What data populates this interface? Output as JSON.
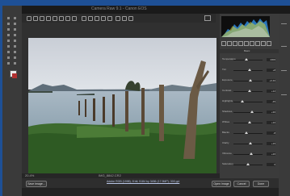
{
  "window": {
    "title": "Camera Raw 9.1 - Canon EOS"
  },
  "panel": {
    "section_title": "Basic",
    "adjustments": [
      {
        "label": "Temperature",
        "value": "4300",
        "level": 0.45
      },
      {
        "label": "Tint",
        "value": "+8",
        "level": 0.55
      },
      {
        "label": "Exposure",
        "value": "+0.40",
        "level": 0.58
      },
      {
        "label": "Contrast",
        "value": "+12",
        "level": 0.55
      },
      {
        "label": "Highlights",
        "value": "-45",
        "level": 0.3
      },
      {
        "label": "Shadows",
        "value": "+30",
        "level": 0.65
      },
      {
        "label": "Whites",
        "value": "+10",
        "level": 0.55
      },
      {
        "label": "Blacks",
        "value": "-8",
        "level": 0.45
      },
      {
        "label": "Clarity",
        "value": "+15",
        "level": 0.58
      },
      {
        "label": "Vibrance",
        "value": "+20",
        "level": 0.6
      },
      {
        "label": "Saturation",
        "value": "0",
        "level": 0.5
      }
    ]
  },
  "status": {
    "zoom": "20.4%",
    "filename": "IMG_8842.CR2"
  },
  "footer": {
    "save_label": "Save Image...",
    "workflow_link": "Adobe RGB (1998); 8 bit; 5184 by 3456 (17.9MP); 300 ppi",
    "open_label": "Open Image",
    "cancel_label": "Cancel",
    "done_label": "Done"
  },
  "colors": {
    "desktop": "#1e5096",
    "accent": "#2f8ee6"
  }
}
